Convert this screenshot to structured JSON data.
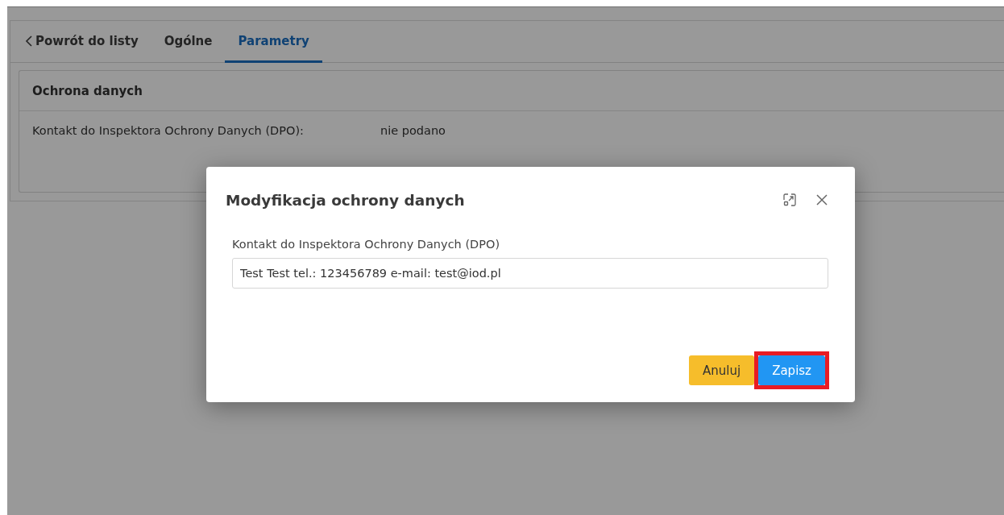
{
  "tabs": [
    {
      "label": "Powrót do listy",
      "kind": "back",
      "selected": false
    },
    {
      "label": "Ogólne",
      "kind": "tab",
      "selected": false
    },
    {
      "label": "Parametry",
      "kind": "tab",
      "selected": true
    }
  ],
  "card": {
    "title": "Ochrona danych",
    "rows": [
      {
        "label": "Kontakt do Inspektora Ochrony Danych (DPO):",
        "value": "nie podano"
      }
    ]
  },
  "dialog": {
    "title": "Modyfikacja ochrony danych",
    "field": {
      "label": "Kontakt do Inspektora Ochrony Danych (DPO)",
      "value": "Test Test tel.: 123456789 e-mail: test@iod.pl"
    },
    "buttons": [
      {
        "label": "Anuluj",
        "kind": "cancel",
        "highlighted": false
      },
      {
        "label": "Zapisz",
        "kind": "primary",
        "highlighted": true
      }
    ]
  }
}
